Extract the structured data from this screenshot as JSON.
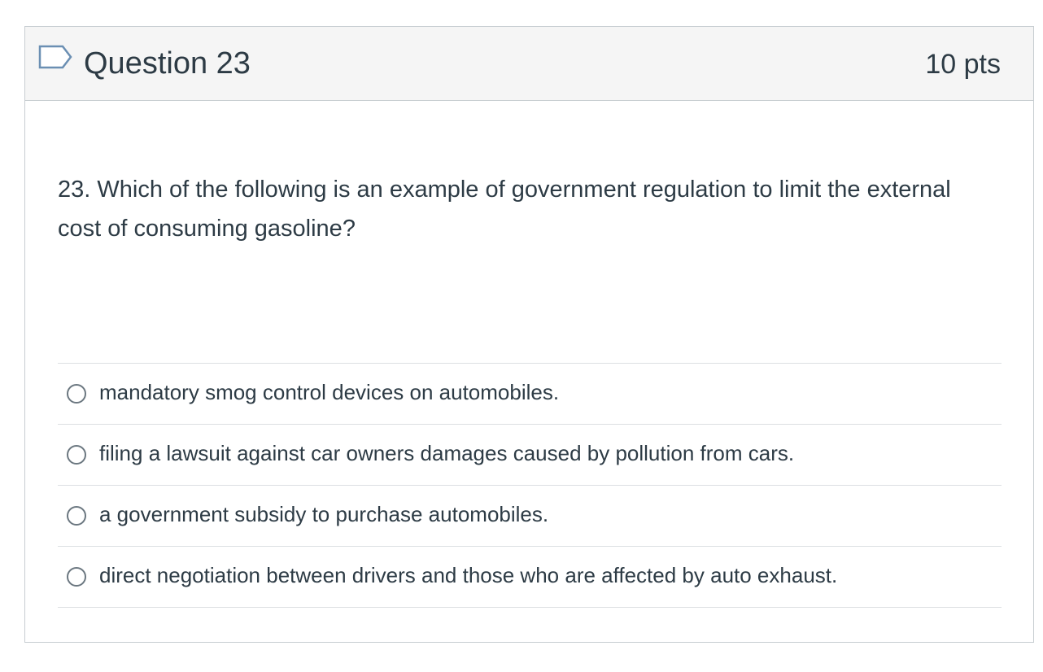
{
  "question": {
    "title": "Question 23",
    "points": "10 pts",
    "text": "23.  Which of the following is an example of government regulation to limit the external cost of consuming gasoline?",
    "answers": [
      {
        "label": "mandatory smog control devices on automobiles."
      },
      {
        "label": "filing a lawsuit against car owners damages caused by pollution from cars."
      },
      {
        "label": "a government subsidy to purchase automobiles."
      },
      {
        "label": "direct negotiation between drivers and those who are affected by auto exhaust."
      }
    ]
  },
  "colors": {
    "header_bg": "#f5f5f5",
    "border": "#c7cdd1",
    "text": "#2d3b45",
    "flag_icon": "#6b8fb3",
    "radio_border": "#6b7780"
  },
  "icons": {
    "flag": "flag-question-icon",
    "radio": "radio-button-icon"
  }
}
